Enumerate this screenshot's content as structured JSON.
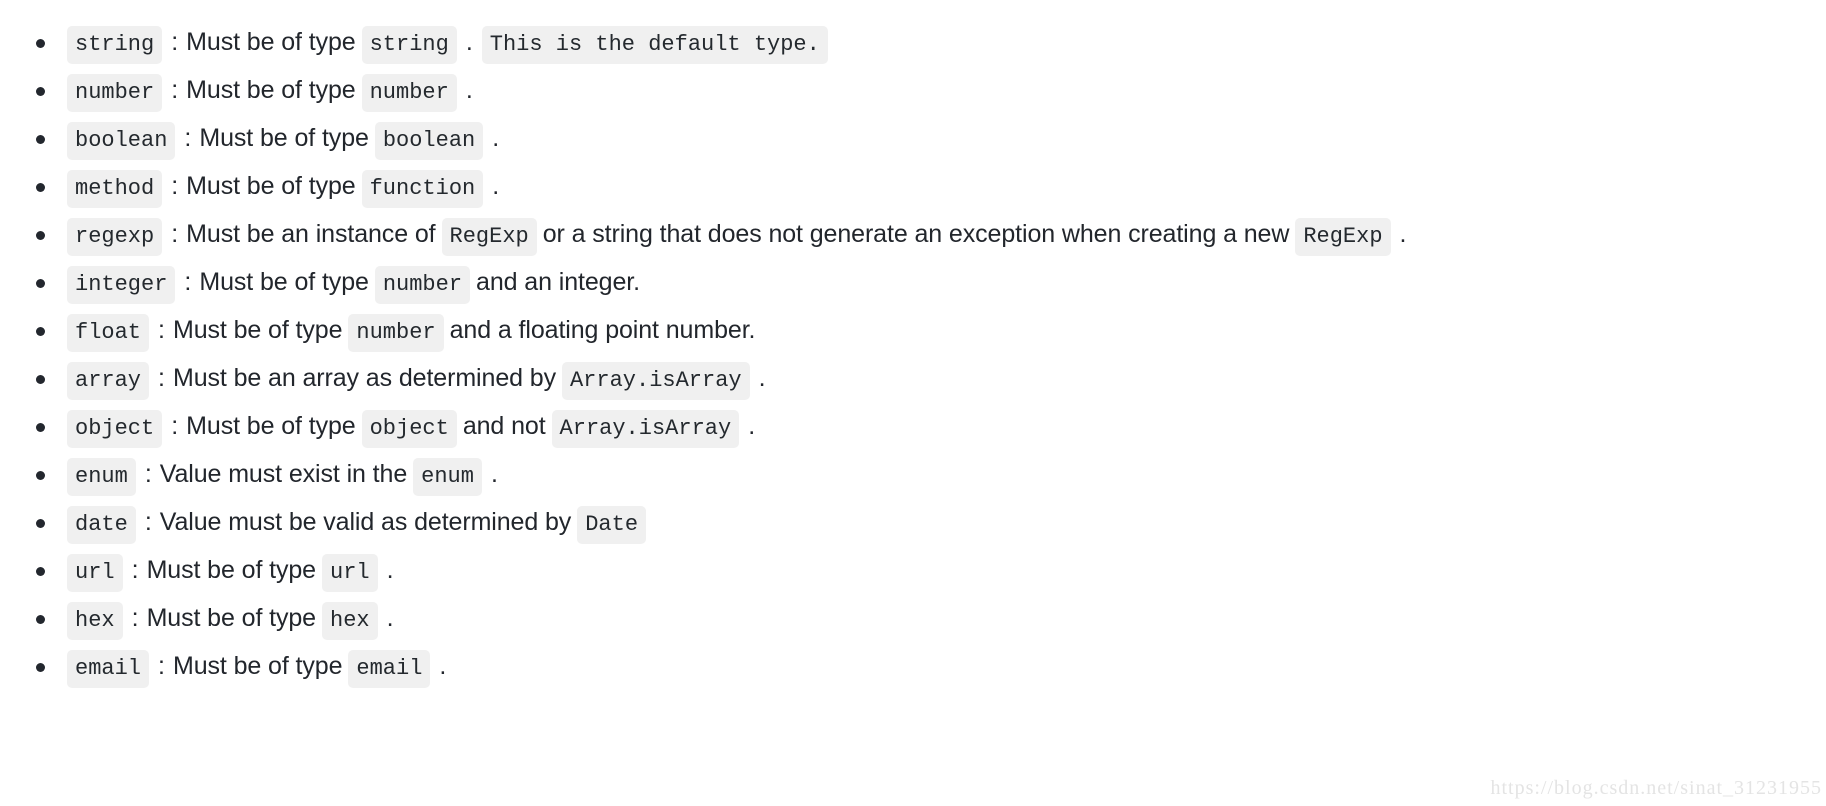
{
  "document": {
    "kind": "documentation-bulleted-list",
    "background_color": "#ffffff",
    "text_color": "#22262c",
    "code_chip_background": "#f0f0f0",
    "code_chip_text_color": "#24292e",
    "bullet_color": "#23272e"
  },
  "watermark": {
    "text": "https://blog.csdn.net/sinat_31231955",
    "color": "#e4e4e4"
  },
  "rules": [
    {
      "name": "string",
      "segments": [
        {
          "kind": "code",
          "text": "string"
        },
        {
          "kind": "punct",
          "text": ":"
        },
        {
          "kind": "text",
          "text": "Must be of type"
        },
        {
          "kind": "code",
          "text": "string"
        },
        {
          "kind": "punct",
          "text": "."
        },
        {
          "kind": "code",
          "text": "This is the default type."
        }
      ]
    },
    {
      "name": "number",
      "segments": [
        {
          "kind": "code",
          "text": "number"
        },
        {
          "kind": "punct",
          "text": ":"
        },
        {
          "kind": "text",
          "text": "Must be of type"
        },
        {
          "kind": "code",
          "text": "number"
        },
        {
          "kind": "punct",
          "text": "."
        }
      ]
    },
    {
      "name": "boolean",
      "segments": [
        {
          "kind": "code",
          "text": "boolean"
        },
        {
          "kind": "punct",
          "text": ":"
        },
        {
          "kind": "text",
          "text": "Must be of type"
        },
        {
          "kind": "code",
          "text": "boolean"
        },
        {
          "kind": "punct",
          "text": "."
        }
      ]
    },
    {
      "name": "method",
      "segments": [
        {
          "kind": "code",
          "text": "method"
        },
        {
          "kind": "punct",
          "text": ":"
        },
        {
          "kind": "text",
          "text": "Must be of type"
        },
        {
          "kind": "code",
          "text": "function"
        },
        {
          "kind": "punct",
          "text": "."
        }
      ]
    },
    {
      "name": "regexp",
      "segments": [
        {
          "kind": "code",
          "text": "regexp"
        },
        {
          "kind": "punct",
          "text": ":"
        },
        {
          "kind": "text",
          "text": "Must be an instance of"
        },
        {
          "kind": "code",
          "text": "RegExp"
        },
        {
          "kind": "text",
          "text": "or a string that does not generate an exception when creating a new"
        },
        {
          "kind": "code",
          "text": "RegExp"
        },
        {
          "kind": "punct",
          "text": "."
        }
      ]
    },
    {
      "name": "integer",
      "segments": [
        {
          "kind": "code",
          "text": "integer"
        },
        {
          "kind": "punct",
          "text": ":"
        },
        {
          "kind": "text",
          "text": "Must be of type"
        },
        {
          "kind": "code",
          "text": "number"
        },
        {
          "kind": "text",
          "text": "and an integer."
        }
      ]
    },
    {
      "name": "float",
      "segments": [
        {
          "kind": "code",
          "text": "float"
        },
        {
          "kind": "punct",
          "text": ":"
        },
        {
          "kind": "text",
          "text": "Must be of type"
        },
        {
          "kind": "code",
          "text": "number"
        },
        {
          "kind": "text",
          "text": "and a floating point number."
        }
      ]
    },
    {
      "name": "array",
      "segments": [
        {
          "kind": "code",
          "text": "array"
        },
        {
          "kind": "punct",
          "text": ":"
        },
        {
          "kind": "text",
          "text": "Must be an array as determined by"
        },
        {
          "kind": "code",
          "text": "Array.isArray"
        },
        {
          "kind": "punct",
          "text": "."
        }
      ]
    },
    {
      "name": "object",
      "segments": [
        {
          "kind": "code",
          "text": "object"
        },
        {
          "kind": "punct",
          "text": ":"
        },
        {
          "kind": "text",
          "text": "Must be of type"
        },
        {
          "kind": "code",
          "text": "object"
        },
        {
          "kind": "text",
          "text": "and not"
        },
        {
          "kind": "code",
          "text": "Array.isArray"
        },
        {
          "kind": "punct",
          "text": "."
        }
      ]
    },
    {
      "name": "enum",
      "segments": [
        {
          "kind": "code",
          "text": "enum"
        },
        {
          "kind": "punct",
          "text": ":"
        },
        {
          "kind": "text",
          "text": "Value must exist in the"
        },
        {
          "kind": "code",
          "text": "enum"
        },
        {
          "kind": "punct",
          "text": "."
        }
      ]
    },
    {
      "name": "date",
      "segments": [
        {
          "kind": "code",
          "text": "date"
        },
        {
          "kind": "punct",
          "text": ":"
        },
        {
          "kind": "text",
          "text": "Value must be valid as determined by"
        },
        {
          "kind": "code",
          "text": "Date"
        }
      ]
    },
    {
      "name": "url",
      "segments": [
        {
          "kind": "code",
          "text": "url"
        },
        {
          "kind": "punct",
          "text": ":"
        },
        {
          "kind": "text",
          "text": "Must be of type"
        },
        {
          "kind": "code",
          "text": "url"
        },
        {
          "kind": "punct",
          "text": "."
        }
      ]
    },
    {
      "name": "hex",
      "segments": [
        {
          "kind": "code",
          "text": "hex"
        },
        {
          "kind": "punct",
          "text": ":"
        },
        {
          "kind": "text",
          "text": "Must be of type"
        },
        {
          "kind": "code",
          "text": "hex"
        },
        {
          "kind": "punct",
          "text": "."
        }
      ]
    },
    {
      "name": "email",
      "segments": [
        {
          "kind": "code",
          "text": "email"
        },
        {
          "kind": "punct",
          "text": ":"
        },
        {
          "kind": "text",
          "text": "Must be of type"
        },
        {
          "kind": "code",
          "text": "email"
        },
        {
          "kind": "punct",
          "text": "."
        }
      ]
    }
  ]
}
